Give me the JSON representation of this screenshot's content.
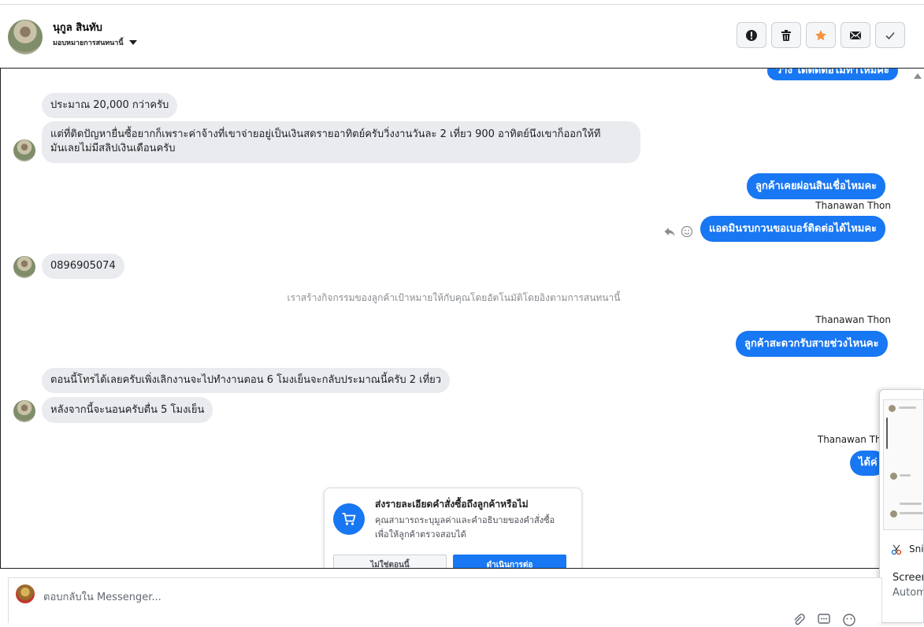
{
  "header": {
    "contact_name": "นุกูล สินทับ",
    "assign_label": "มอบหมายการสนทนานี้",
    "actions": [
      {
        "icon": "exclamation-circle-icon",
        "name": "spam-button"
      },
      {
        "icon": "trash-icon",
        "name": "delete-button"
      },
      {
        "icon": "star-icon",
        "name": "star-button"
      },
      {
        "icon": "envelope-icon",
        "name": "mark-unread-button"
      },
      {
        "icon": "check-icon",
        "name": "done-button"
      }
    ]
  },
  "thread": {
    "partial_top": "ว่าง ได้ติดต่อไม่ทำไหมคะ",
    "msg1": "ประมาณ 20,000 กว่าครับ",
    "msg2_line1": "แต่ที่ติดปัญหายื่นซื้อยากก็เพราะค่าจ้างที่เขาจ่ายอยู่เป็นเงินสดรายอาทิตย์ครับวิ่งงานวันละ 2 เที่ยว 900 อาทิตย์นึงเขาก็ออกให้ที",
    "msg2_line2": "มันเลยไม่มีสลิปเงินเดือนครับ",
    "out1": "ลูกค้าเคยผ่อนสินเชื่อไหมคะ",
    "sender1": "Thanawan Thon",
    "out2": "แอดมินรบกวนขอเบอร์ติดต่อได้ไหมคะ",
    "msg3": "0896905074",
    "system_note": "เราสร้างกิจกรรมของลูกค้าเป้าหมายให้กับคุณโดยอัตโนมัติโดยอิงตามการสนทนานี้",
    "sender2": "Thanawan Thon",
    "out3": "ลูกค้าสะดวกรับสายช่วงไหนคะ",
    "msg4": "ตอนนี้โทรได้เลยครับเพิ่งเลิกงานจะไปทำงานตอน 6 โมงเย็นจะกลับประมาณนี้ครับ 2 เที่ยว",
    "msg5": "หลังจากนี้จะนอนครับตื่น 5 โมงเย็น",
    "sender3": "Thanawan Tho",
    "out4": "ได้ค่"
  },
  "promo": {
    "title": "ส่งรายละเอียดคำสั่งซื้อถึงลูกค้าหรือไม่",
    "body_line1": "คุณสามารถระบุมูลค่าและคำอธิบายของคำสั่งซื้อ",
    "body_line2": "เพื่อให้ลูกค้าตรวจสอบได้",
    "secondary_label": "ไม่ใช่ตอนนี้",
    "primary_label": "ดำเนินการต่อ"
  },
  "popup": {
    "snip_label": "Sni",
    "toast_line1": "Screen",
    "toast_line2": "Autom"
  },
  "composer": {
    "placeholder": "ตอบกลับใน Messenger..."
  },
  "colors": {
    "messenger_blue": "#1877f2",
    "incoming_bubble": "#e9ebee",
    "star_orange": "#f7923b"
  }
}
